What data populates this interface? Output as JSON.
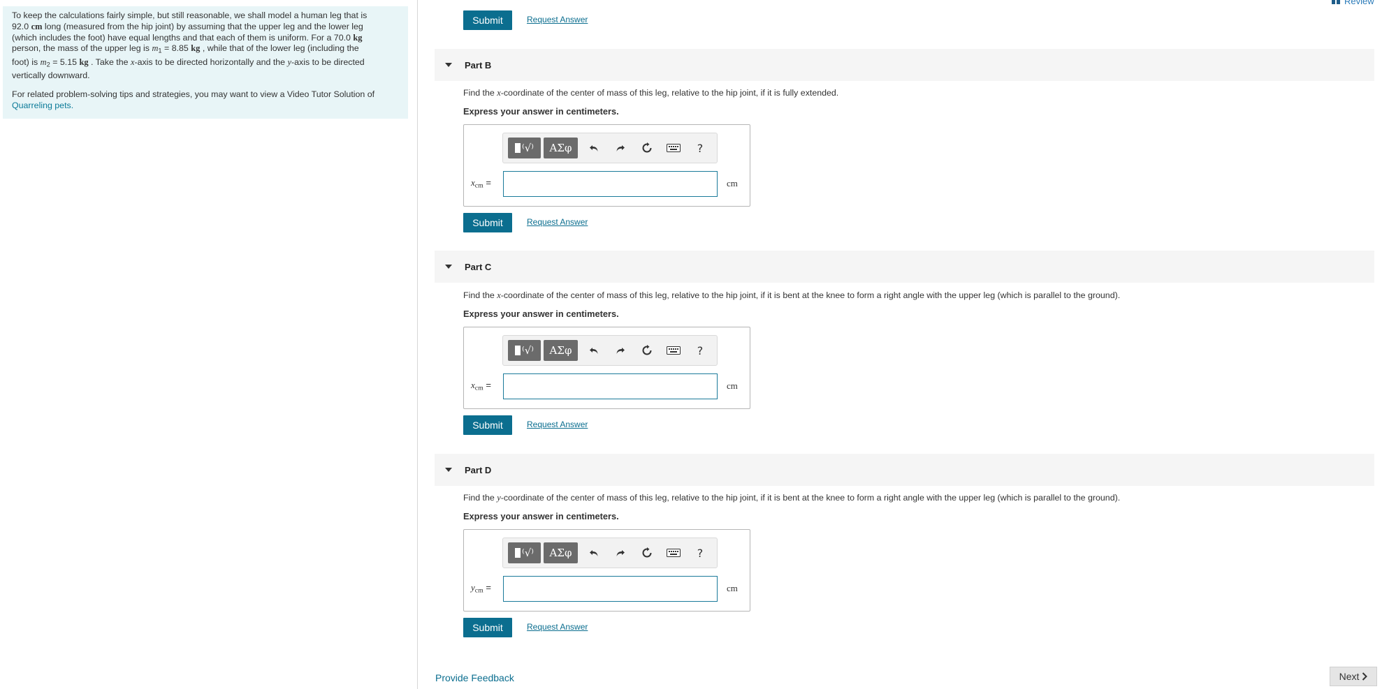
{
  "intro": {
    "line1": "To keep the calculations fairly simple, but still reasonable, we shall model a human leg that is",
    "length_value": "92.0",
    "length_unit": "cm",
    "line2_rest": "long (measured from the hip joint) by assuming that the upper leg and the lower leg",
    "line3": "(which includes the foot) have equal lengths and that each of them is uniform. For a",
    "person_mass_value": "70.0",
    "person_mass_unit": "kg",
    "line4a": "person, the mass of the upper leg is",
    "m1_symbol": "m",
    "m1_sub": "1",
    "m1_value": "= 8.85",
    "m1_unit": "kg",
    "line4b": ", while that of the lower leg (including the",
    "line5a": "foot) is",
    "m2_symbol": "m",
    "m2_sub": "2",
    "m2_value": "= 5.15",
    "m2_unit": "kg",
    "line5b": ". Take the",
    "x_symbol": "x",
    "line5c": "-axis to be directed horizontally and the",
    "y_symbol": "y",
    "line5d": "-axis to be directed",
    "line6": "vertically downward.",
    "tips_text": "For related problem-solving tips and strategies, you may want to view a Video Tutor Solution of",
    "tips_link": "Quarreling pets."
  },
  "review_label": "Review",
  "submit_label": "Submit",
  "request_answer_label": "Request Answer",
  "hint_text": "Express your answer in centimeters.",
  "unit": "cm",
  "parts": [
    {
      "title": "Part B",
      "q_before": "Find the",
      "axis": "x",
      "q_after": "-coordinate of the center of mass of this leg, relative to the hip joint, if it is fully extended.",
      "var_symbol": "x",
      "var_sub": "cm",
      "input_value": ""
    },
    {
      "title": "Part C",
      "q_before": "Find the",
      "axis": "x",
      "q_after": "-coordinate of the center of mass of this leg, relative to the hip joint, if it is bent at the knee to form a right angle with the upper leg (which is parallel to the ground).",
      "var_symbol": "x",
      "var_sub": "cm",
      "input_value": ""
    },
    {
      "title": "Part D",
      "q_before": "Find the",
      "axis": "y",
      "q_after": "-coordinate of the center of mass of this leg, relative to the hip joint, if it is bent at the knee to form a right angle with the upper leg (which is parallel to the ground).",
      "var_symbol": "y",
      "var_sub": "cm",
      "input_value": ""
    }
  ],
  "toolbar": {
    "greek_label": "ΑΣφ",
    "help_label": "?",
    "icons": [
      "templates-icon",
      "greek-icon",
      "undo-icon",
      "redo-icon",
      "reset-icon",
      "keyboard-icon",
      "help-icon"
    ]
  },
  "footer": {
    "feedback_label": "Provide Feedback",
    "next_label": "Next"
  }
}
